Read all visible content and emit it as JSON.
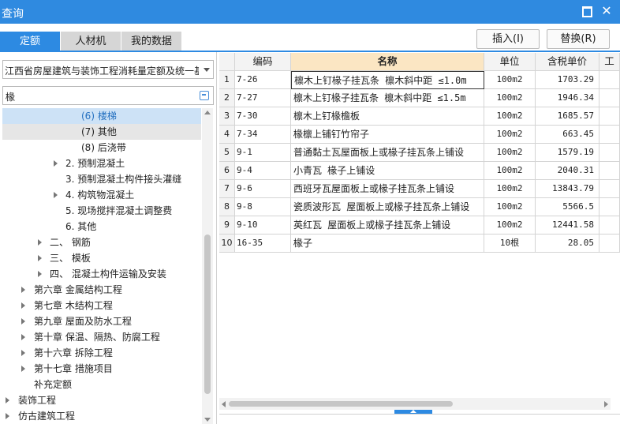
{
  "window": {
    "title": "查询"
  },
  "tabs": [
    {
      "label": "定额",
      "active": true
    },
    {
      "label": "人材机",
      "active": false
    },
    {
      "label": "我的数据",
      "active": false
    }
  ],
  "actions": {
    "insert_label": "插入(I)",
    "replace_label": "替换(R)"
  },
  "library": {
    "selected": "江西省房屋建筑与装饰工程消耗量定额及统一基"
  },
  "search": {
    "value": "椽"
  },
  "tree": [
    {
      "label": "(6) 楼梯",
      "level": 4,
      "expander": false,
      "state": "selected"
    },
    {
      "label": "(7) 其他",
      "level": 4,
      "expander": false,
      "state": "hover"
    },
    {
      "label": "(8) 后浇带",
      "level": 4,
      "expander": false,
      "state": ""
    },
    {
      "label": "2. 预制混凝土",
      "level": 3,
      "expander": true,
      "state": ""
    },
    {
      "label": "3. 预制混凝土构件接头灌缝",
      "level": 3,
      "expander": false,
      "state": ""
    },
    {
      "label": "4. 构筑物混凝土",
      "level": 3,
      "expander": true,
      "state": ""
    },
    {
      "label": "5. 现场搅拌混凝土调整费",
      "level": 3,
      "expander": false,
      "state": ""
    },
    {
      "label": "6. 其他",
      "level": 3,
      "expander": false,
      "state": ""
    },
    {
      "label": "二、 钢筋",
      "level": 2,
      "expander": true,
      "state": ""
    },
    {
      "label": "三、 模板",
      "level": 2,
      "expander": true,
      "state": ""
    },
    {
      "label": "四、 混凝土构件运输及安装",
      "level": 2,
      "expander": true,
      "state": ""
    },
    {
      "label": "第六章 金属结构工程",
      "level": 1,
      "expander": true,
      "state": ""
    },
    {
      "label": "第七章 木结构工程",
      "level": 1,
      "expander": true,
      "state": ""
    },
    {
      "label": "第九章 屋面及防水工程",
      "level": 1,
      "expander": true,
      "state": ""
    },
    {
      "label": "第十章 保温、隔热、防腐工程",
      "level": 1,
      "expander": true,
      "state": ""
    },
    {
      "label": "第十六章 拆除工程",
      "level": 1,
      "expander": true,
      "state": ""
    },
    {
      "label": "第十七章 措施项目",
      "level": 1,
      "expander": true,
      "state": ""
    },
    {
      "label": "补充定额",
      "level": 1,
      "expander": false,
      "state": ""
    },
    {
      "label": "装饰工程",
      "level": 0,
      "expander": true,
      "state": ""
    },
    {
      "label": "仿古建筑工程",
      "level": 0,
      "expander": true,
      "state": ""
    }
  ],
  "table": {
    "columns": [
      "编码",
      "名称",
      "单位",
      "含税单价",
      "工"
    ],
    "rows": [
      {
        "no": "1",
        "code": "7-26",
        "name": "檩木上钉椽子挂瓦条 檩木斜中距 ≤1.0m",
        "unit": "100m2",
        "price": "1703.29"
      },
      {
        "no": "2",
        "code": "7-27",
        "name": "檩木上钉椽子挂瓦条 檩木斜中距 ≤1.5m",
        "unit": "100m2",
        "price": "1946.34"
      },
      {
        "no": "3",
        "code": "7-30",
        "name": "檩木上钉椽檐板",
        "unit": "100m2",
        "price": "1685.57"
      },
      {
        "no": "4",
        "code": "7-34",
        "name": "椽檩上铺钉竹帘子",
        "unit": "100m2",
        "price": "663.45"
      },
      {
        "no": "5",
        "code": "9-1",
        "name": "普通黏土瓦屋面板上或椽子挂瓦条上铺设",
        "unit": "100m2",
        "price": "1579.19"
      },
      {
        "no": "6",
        "code": "9-4",
        "name": "小青瓦 椽子上铺设",
        "unit": "100m2",
        "price": "2040.31"
      },
      {
        "no": "7",
        "code": "9-6",
        "name": "西班牙瓦屋面板上或椽子挂瓦条上铺设",
        "unit": "100m2",
        "price": "13843.79"
      },
      {
        "no": "8",
        "code": "9-8",
        "name": "瓷质波形瓦 屋面板上或椽子挂瓦条上铺设",
        "unit": "100m2",
        "price": "5566.5"
      },
      {
        "no": "9",
        "code": "9-10",
        "name": "英红瓦 屋面板上或椽子挂瓦条上铺设",
        "unit": "100m2",
        "price": "12441.58"
      },
      {
        "no": "10",
        "code": "16-35",
        "name": "椽子",
        "unit": "10根",
        "price": "28.05"
      }
    ]
  }
}
